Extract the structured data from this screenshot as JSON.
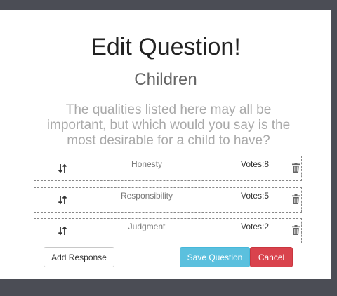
{
  "modal": {
    "title": "Edit Question!",
    "subtitle": "Children",
    "question": "The qualities listed here may all be important, but which would you say is the most desirable for a child to have?"
  },
  "responses": [
    {
      "label": "Honesty",
      "votes": "Votes:8"
    },
    {
      "label": "Responsibility",
      "votes": "Votes:5"
    },
    {
      "label": "Judgment",
      "votes": "Votes:2"
    }
  ],
  "buttons": {
    "add_response": "Add Response",
    "save_question": "Save Question",
    "cancel": "Cancel"
  },
  "icons": {
    "sort": "sort-arrows-icon",
    "delete": "trash-icon"
  },
  "colors": {
    "save": "#5bc0de",
    "cancel": "#d9434d",
    "backdrop": "#4b4d55"
  }
}
